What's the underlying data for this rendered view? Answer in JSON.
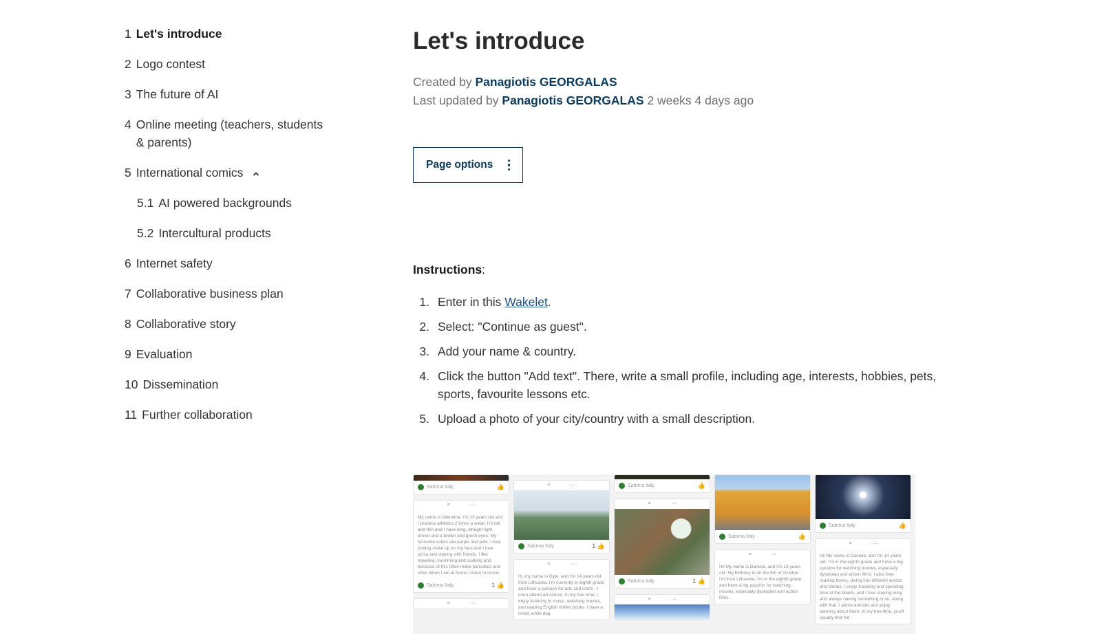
{
  "toc": [
    {
      "num": "1",
      "label": "Let's introduce",
      "active": true
    },
    {
      "num": "2",
      "label": "Logo contest"
    },
    {
      "num": "3",
      "label": "The future of AI"
    },
    {
      "num": "4",
      "label": "Online meeting (teachers, students & parents)"
    },
    {
      "num": "5",
      "label": "International comics",
      "expanded": true
    },
    {
      "num": "5.1",
      "label": "AI powered backgrounds",
      "sub": true
    },
    {
      "num": "5.2",
      "label": "Intercultural products",
      "sub": true
    },
    {
      "num": "6",
      "label": "Internet safety"
    },
    {
      "num": "7",
      "label": "Collaborative business plan"
    },
    {
      "num": "8",
      "label": "Collaborative story"
    },
    {
      "num": "9",
      "label": "Evaluation"
    },
    {
      "num": "10",
      "label": "Dissemination"
    },
    {
      "num": "11",
      "label": "Further collaboration"
    }
  ],
  "page": {
    "title": "Let's introduce",
    "created_prefix": "Created by",
    "created_by": "Panagiotis GEORGALAS",
    "updated_prefix": "Last updated by",
    "updated_by": "Panagiotis GEORGALAS",
    "updated_when": "2 weeks 4 days ago",
    "options_label": "Page options"
  },
  "instructions": {
    "heading": "Instructions",
    "steps": [
      {
        "num": "1.",
        "before": "Enter in this ",
        "link": "Wakelet",
        "after": "."
      },
      {
        "num": "2.",
        "text": "Select: \"Continue as guest\"."
      },
      {
        "num": "3.",
        "text": "Add your name & country."
      },
      {
        "num": "4.",
        "text": "Click the button \"Add text\". There, write a small profile, including age, interests, hobbies, pets, sports, favourite lessons etc."
      },
      {
        "num": "5.",
        "text": "Upload a photo of your city/country with a small description."
      }
    ]
  },
  "embedded_image": {
    "author_tag": "Sabrina Italy",
    "snippets": [
      "My name is Valentina. I'm 13 years old and I practice athletics 2 times a week. I'm tall and thin and I have long, straight light brown and a brown and green eyes. My favourite colors are purple and pink. I love putting make up on my face and I love pizza and staying with friends. I like traveling, swimming and cooking and because of this often make pancakes and often when I am at home I listen to music.",
      "Hi, my name is Gyte, and I'm 14 years old from Lithuania. I'm currently in eighth grade and have a passion for arts and crafts - I even attend art school. In my free time, I enjoy listening to music, watching movies, and reading English thriller books. I have a small, white dog",
      "Hi! My name is Daniela, and I'm 13 years old. My birthday is on the 5th of October. I'm from Lithuania. I'm in the eighth grade and have a big passion for watching movies, especially dystopian and action films.",
      "Hi! My name is Daniela, and I'm 14 years old. I'm in the eighth grade and have a big passion for watching movies, especially dystopian and action films. I also love reading books, diving into different worlds and stories. I enjoy traveling and spending time at the beach, and I love staying busy and always having something to do. Along with that, I adore animals and enjoy learning about them. In my free time, you'll usually find me"
    ]
  },
  "colors": {
    "accent": "#0b3a5c",
    "link": "#1f4f82",
    "text": "#333333",
    "muted": "#707070"
  }
}
